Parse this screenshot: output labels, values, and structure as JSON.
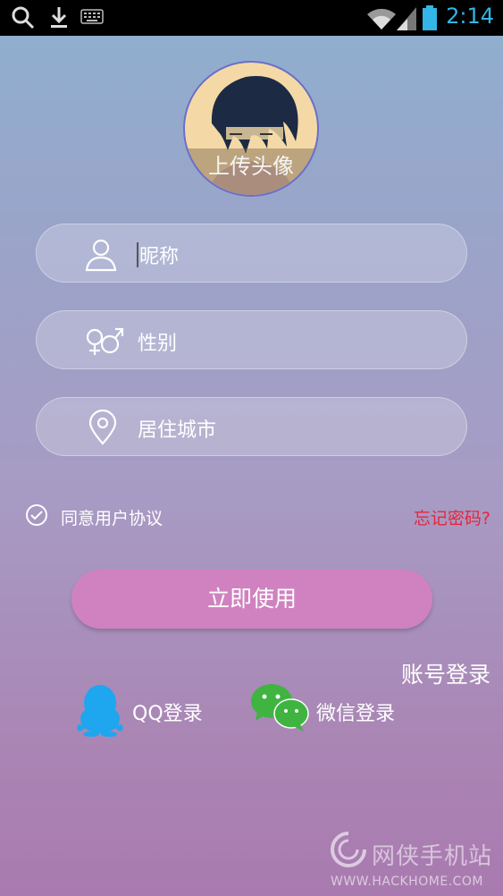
{
  "status_bar": {
    "time": "2:14",
    "icons": [
      "search-icon",
      "download-icon",
      "keyboard-icon",
      "wifi-icon",
      "signal-icon",
      "battery-icon"
    ]
  },
  "avatar": {
    "label": "上传头像"
  },
  "form": {
    "nickname_placeholder": "昵称",
    "gender_placeholder": "性别",
    "city_placeholder": "居住城市"
  },
  "agreement": {
    "label": "同意用户协议",
    "checked": true
  },
  "forgot_password": "忘记密码?",
  "primary_button": "立即使用",
  "account_login": "账号登录",
  "social": {
    "qq_label": "QQ登录",
    "wechat_label": "微信登录"
  },
  "watermark": {
    "name": "网侠手机站",
    "url": "WWW.HACKHOME.COM"
  },
  "colors": {
    "accent_button": "#d082c0",
    "forgot_red": "#e8253c",
    "qq_blue": "#1ea6ef",
    "wechat_green": "#3fb440",
    "time_blue": "#33b5e5"
  }
}
